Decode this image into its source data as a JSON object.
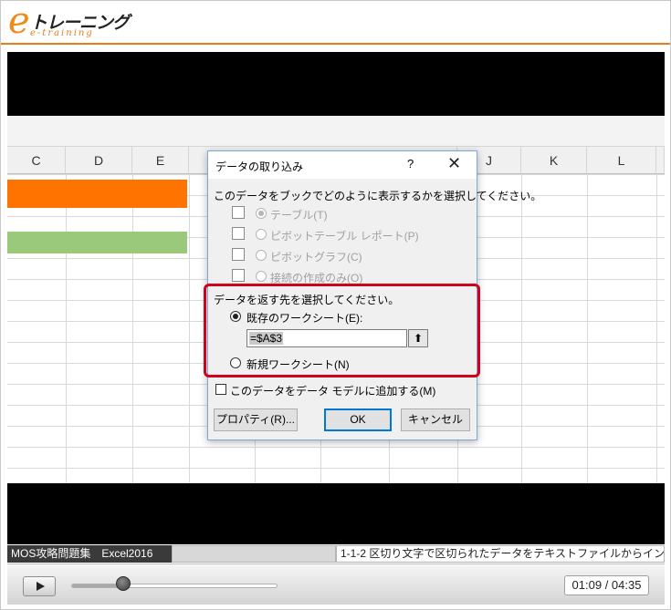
{
  "header": {
    "logo_e": "e",
    "logo_main": "トレーニング",
    "logo_sub": "e-training"
  },
  "excel": {
    "columns": [
      "C",
      "D",
      "E",
      "J",
      "K",
      "L"
    ],
    "colors": {
      "orange_cells": "#ff7400",
      "green_cells": "#9bc97b"
    }
  },
  "dialog": {
    "title": "データの取り込み",
    "help": "?",
    "close": "✕",
    "prompt": "このデータをブックでどのように表示するかを選択してください。",
    "view_options": [
      {
        "label": "テーブル(T)",
        "selected": true,
        "enabled": false
      },
      {
        "label": "ピボットテーブル レポート(P)",
        "selected": false,
        "enabled": false
      },
      {
        "label": "ピボットグラフ(C)",
        "selected": false,
        "enabled": false
      },
      {
        "label": "接続の作成のみ(O)",
        "selected": false,
        "enabled": false
      }
    ],
    "destination_prompt": "データを返す先を選択してください。",
    "existing_sheet_label": "既存のワークシート(E):",
    "existing_sheet_selected": true,
    "reference_value": "=$A$3",
    "new_sheet_label": "新規ワークシート(N)",
    "add_to_model_label": "このデータをデータ モデルに追加する(M)",
    "add_to_model_checked": false,
    "properties_button": "プロパティ(R)...",
    "ok_button": "OK",
    "cancel_button": "キャンセル",
    "highlight_color": "#d0021b"
  },
  "info_bar": {
    "course": "MOS攻略問題集　Excel2016",
    "lesson": "1-1-2 区切り文字で区切られたデータをテキストファイルからイン"
  },
  "player": {
    "time_display": "01:09 / 04:35",
    "progress_fraction": 0.25
  }
}
